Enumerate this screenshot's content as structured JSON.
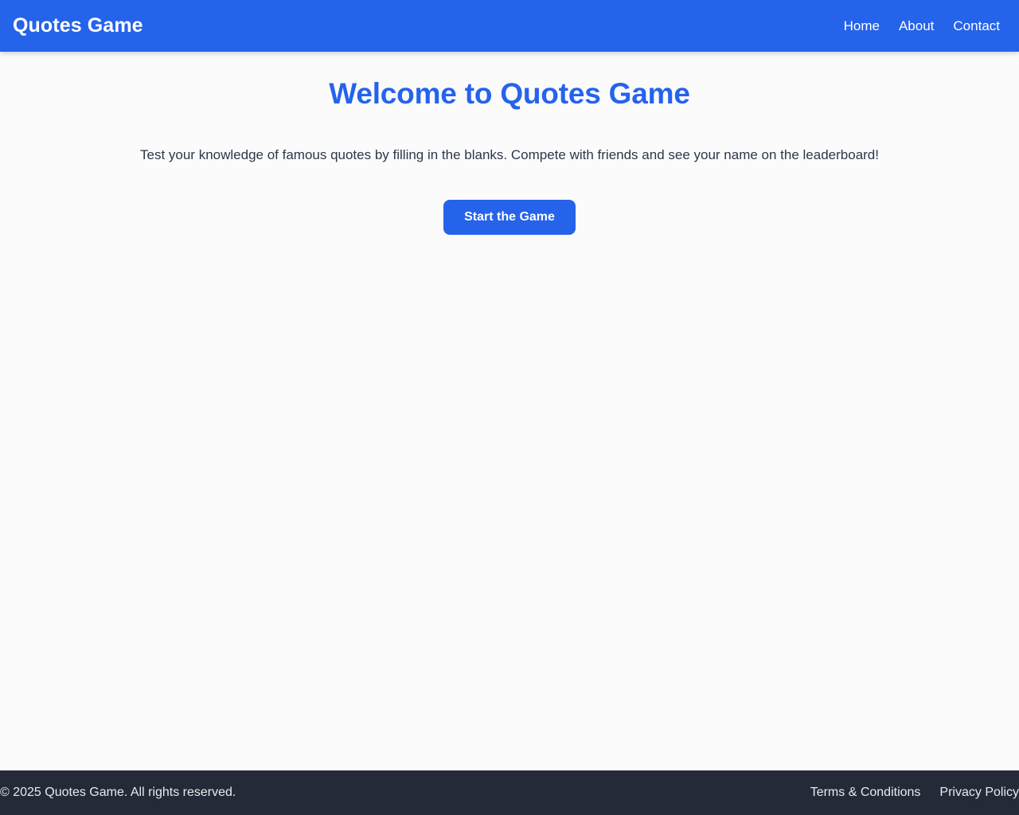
{
  "header": {
    "brand": "Quotes Game",
    "nav": [
      {
        "label": "Home"
      },
      {
        "label": "About"
      },
      {
        "label": "Contact"
      }
    ]
  },
  "main": {
    "title": "Welcome to Quotes Game",
    "description": "Test your knowledge of famous quotes by filling in the blanks. Compete with friends and see your name on the leaderboard!",
    "cta_label": "Start the Game"
  },
  "footer": {
    "copyright": "© 2025 Quotes Game. All rights reserved.",
    "links": [
      {
        "label": "Terms & Conditions"
      },
      {
        "label": "Privacy Policy"
      }
    ]
  },
  "colors": {
    "brand_blue": "#2563eb",
    "footer_dark": "#242a38",
    "body_text": "#2d3748",
    "page_background": "#fbfbfc"
  }
}
